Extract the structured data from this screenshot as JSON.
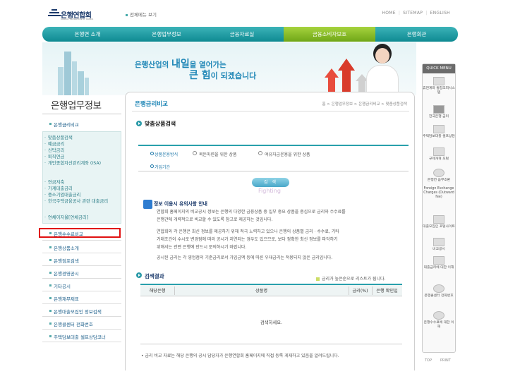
{
  "header": {
    "logo_text": "은행연합회",
    "logo_sub": "KOREA FEDERATION OF BANKS",
    "all_menu": "전체메뉴 보기",
    "top_links": [
      "HOME",
      "SITEMAP",
      "ENGLISH"
    ]
  },
  "gnb": [
    "은행연 소개",
    "은행업무정보",
    "금융자료실",
    "금융소비자보호",
    "은행회관"
  ],
  "banner": {
    "line1_pre": "은행산업의",
    "line1_big": "내일",
    "line1_post": "을 열어가는",
    "line2_big": "큰 힘",
    "line2_post": "이 되겠습니다"
  },
  "lnb": {
    "title": "은행업무정보",
    "top_item": "은행금리비교",
    "sub_items": [
      "맞춤상품검색",
      "예금금리",
      "신탁금리",
      "퇴직연금",
      "개인종합자산관리계좌 (ISA)",
      "연금저축",
      "가계대출금리",
      "중소기업대출금리",
      "한국주택금융공사 관련 대출금리",
      "연체이자율[연체금리]"
    ],
    "items": [
      "은행수수료비교",
      "은행상품소개",
      "은행점포검색",
      "은행경영공시",
      "기타공시",
      "은행재무제표",
      "은행대출모집인 정보검색",
      "은행콜센터 전화번호",
      "주택담보대출 셀프상담코너"
    ]
  },
  "content": {
    "title": "은행금리비교",
    "breadcrumb": "홈 > 은행업무정보 > 은행금리비교 > 맞춤상품검색",
    "section_title": "맞춤상품검색",
    "search": {
      "label1": "상품운용방식",
      "radio1": "목돈마련을 위한 상품",
      "radio2": "여유자금운용을 위한 상품",
      "label2": "가입기간",
      "button": "검 색"
    },
    "watermark": "Fighting",
    "notice": {
      "title": "정보 이용시 유의사항 안내",
      "p1a": "연합회 홈페이지의 비교공시 정보는 은행의 다양한 금융상품 중 일부 중요 상품을 중심으로 금리와 수수료를",
      "p1b": "은행간에 개략적으로 비교할 수 있도록 참고로 제공하는 것입니다.",
      "p2a": "연합회와 각 은행은 최신 정보를 제공하기 위해 적극 노력하고 있으나 은행의 상품별 금리 · 수수료, 기타",
      "p2b": "거래조건이 수시로 변경됨에 따라 공시가 지연되는 경우도 있으므로, 보다 정확한 최신 정보를 파악하기",
      "p2c": "위해서는 관련 은행에 반드시 문의하시기 바랍니다.",
      "p3": "공시된 금리는 각 영업점의 기준금리로서 가입금액 등에 따른 우대금리는 적용되지 않은 금리입니다."
    },
    "results": {
      "title": "검색결과",
      "sort_note": "금리가 높은순으로 리스트가 됩니다.",
      "columns": [
        "해당은행",
        "상품명",
        "금리(%)",
        "은행 확인일"
      ],
      "empty": "검색하세요."
    },
    "footnote": "금리 비교 자료는 해당 은행의 공시 담당자가 은행연합회 홈페이지에 직접 등록 게재하고 있음을 알려드립니다."
  },
  "quick_menu": {
    "title": "QUICK MENU",
    "items": [
      "휴면계좌 통합조회시스템",
      "한국은행 금리",
      "주택담보대출 셀프상담",
      "규제개혁 포털",
      "은행연 음부조판",
      "Foreign Exchange Charges (Outward fee)",
      "대출모집인 포털사이트",
      "비교공시",
      "대출금리에 대한 이해",
      "은행콜센터 전화번호",
      "은행수수료에 대한 이해"
    ],
    "top": "TOP",
    "print": "PRINT"
  },
  "colors": {
    "primary_teal": "#1e9aa4",
    "accent_green": "#8cc63f",
    "highlight_red": "#e01010",
    "link_blue": "#1e86b6"
  }
}
